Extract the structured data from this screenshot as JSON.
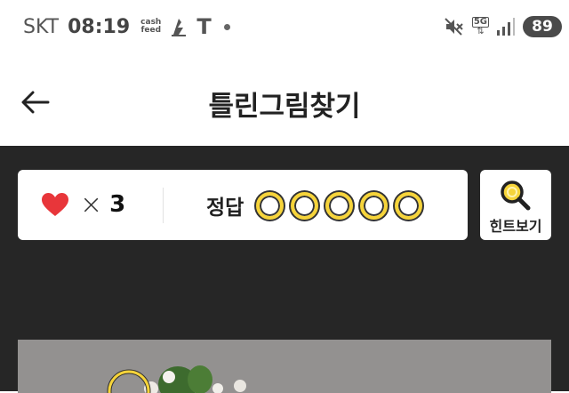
{
  "status_bar": {
    "carrier": "SKT",
    "time": "08:19",
    "cashfeed_line1": "cash",
    "cashfeed_line2": "feed",
    "tmap": "T",
    "network": "5G",
    "battery": "89"
  },
  "header": {
    "title": "틀린그림찾기"
  },
  "game": {
    "lives_count": "3",
    "times_symbol": "×",
    "answers_label": "정답",
    "answer_slots": 5,
    "hint_label": "힌트보기"
  },
  "colors": {
    "background_dark": "#262626",
    "accent_yellow": "#f6d43a",
    "heart_red": "#e8363a"
  }
}
